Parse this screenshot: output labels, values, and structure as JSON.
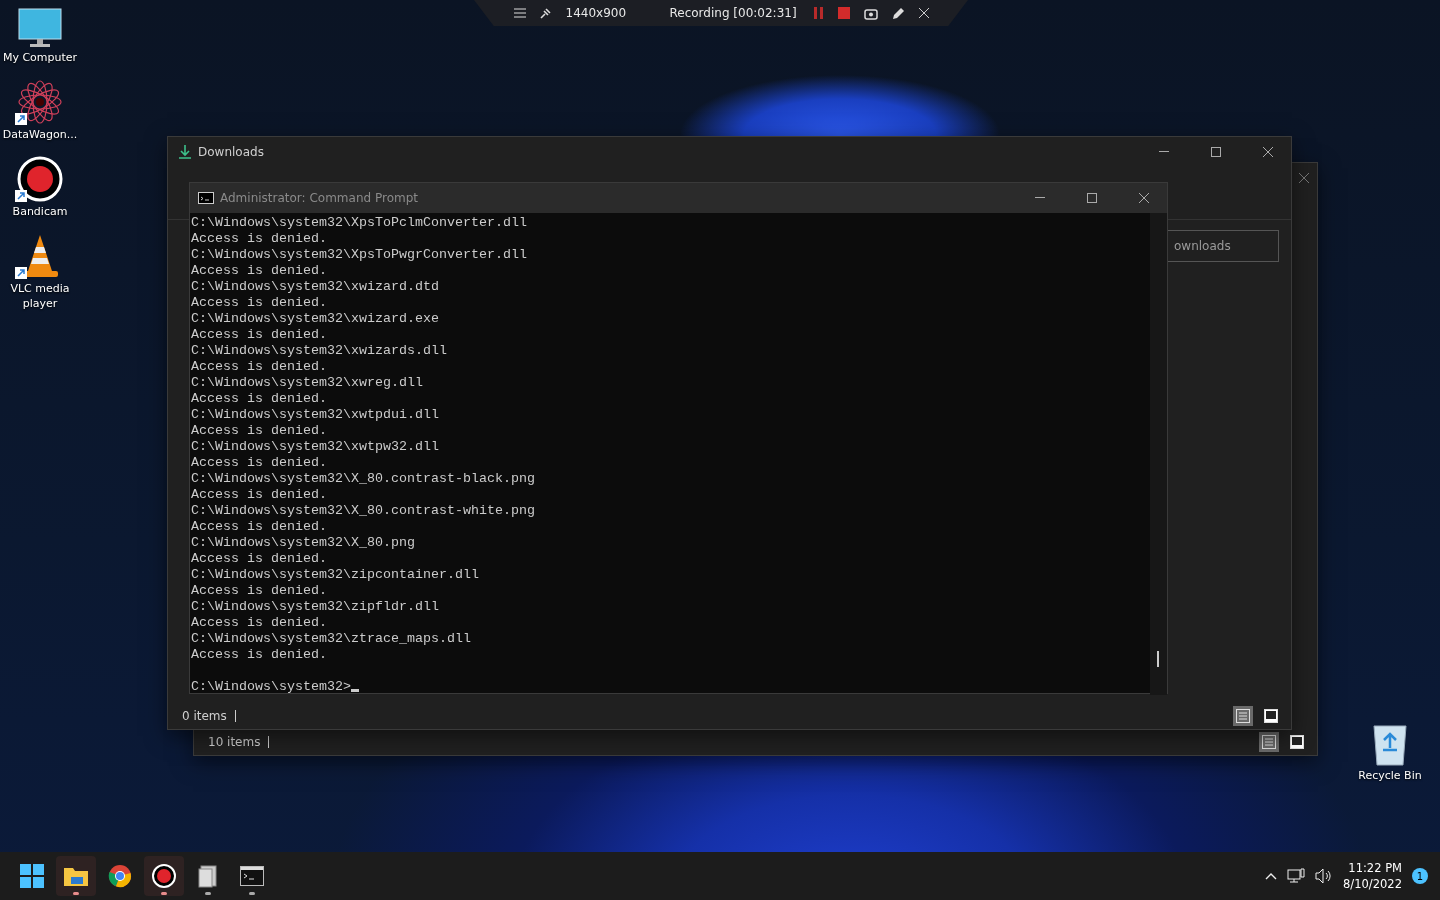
{
  "recorder_bar": {
    "size": "1440x900",
    "status": "Recording [00:02:31]",
    "paused": false
  },
  "desktop_icons": [
    {
      "kind": "computer",
      "label": "My Computer",
      "shortcut": false
    },
    {
      "kind": "star",
      "label": "DataWagon...",
      "shortcut": true
    },
    {
      "kind": "record",
      "label": "Bandicam",
      "shortcut": true
    },
    {
      "kind": "cone",
      "label": "VLC media player",
      "shortcut": true
    }
  ],
  "recycle_bin": {
    "label": "Recycle Bin"
  },
  "back_window": {
    "status": "10 items",
    "details_view": true
  },
  "downloads_window": {
    "title": "Downloads",
    "address": "ownloads",
    "status": "0 items",
    "details_view": true
  },
  "cmd_window": {
    "title": "Administrator: Command Prompt",
    "lines": [
      "C:\\Windows\\system32\\XpsToPclmConverter.dll",
      "Access is denied.",
      "C:\\Windows\\system32\\XpsToPwgrConverter.dll",
      "Access is denied.",
      "C:\\Windows\\system32\\xwizard.dtd",
      "Access is denied.",
      "C:\\Windows\\system32\\xwizard.exe",
      "Access is denied.",
      "C:\\Windows\\system32\\xwizards.dll",
      "Access is denied.",
      "C:\\Windows\\system32\\xwreg.dll",
      "Access is denied.",
      "C:\\Windows\\system32\\xwtpdui.dll",
      "Access is denied.",
      "C:\\Windows\\system32\\xwtpw32.dll",
      "Access is denied.",
      "C:\\Windows\\system32\\X_80.contrast-black.png",
      "Access is denied.",
      "C:\\Windows\\system32\\X_80.contrast-white.png",
      "Access is denied.",
      "C:\\Windows\\system32\\X_80.png",
      "Access is denied.",
      "C:\\Windows\\system32\\zipcontainer.dll",
      "Access is denied.",
      "C:\\Windows\\system32\\zipfldr.dll",
      "Access is denied.",
      "C:\\Windows\\system32\\ztrace_maps.dll",
      "Access is denied."
    ],
    "prompt": "C:\\Windows\\system32>"
  },
  "taskbar": {
    "apps": [
      {
        "kind": "start",
        "running": false,
        "active": false
      },
      {
        "kind": "folder",
        "running": true,
        "active": true
      },
      {
        "kind": "browser",
        "running": false,
        "active": false
      },
      {
        "kind": "record",
        "running": true,
        "active": true
      },
      {
        "kind": "app",
        "running": true,
        "active": false
      },
      {
        "kind": "terminal",
        "running": true,
        "active": false
      }
    ],
    "time": "11:22 PM",
    "date": "8/10/2022",
    "notifications": "1"
  }
}
